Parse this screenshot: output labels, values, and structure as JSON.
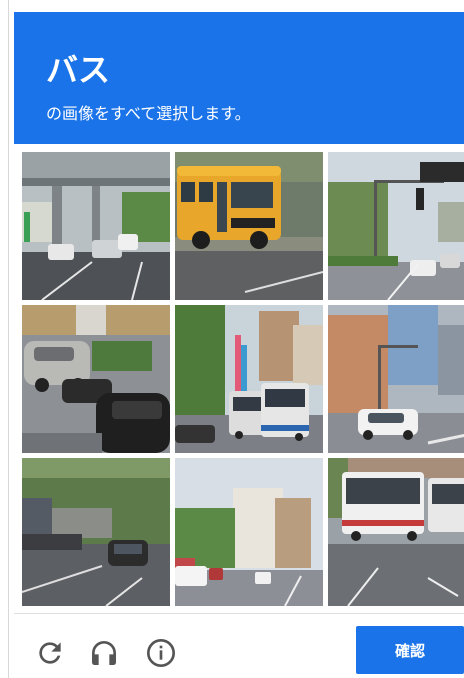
{
  "header": {
    "title": "バス",
    "instruction": "の画像をすべて選択します。"
  },
  "grid": {
    "tiles": [
      {
        "row": 1,
        "col": 1,
        "subject": "street-overpass"
      },
      {
        "row": 1,
        "col": 2,
        "subject": "school-bus"
      },
      {
        "row": 1,
        "col": 3,
        "subject": "traffic-lights"
      },
      {
        "row": 2,
        "col": 1,
        "subject": "parked-cars"
      },
      {
        "row": 2,
        "col": 2,
        "subject": "city-buses"
      },
      {
        "row": 2,
        "col": 3,
        "subject": "intersection-car"
      },
      {
        "row": 3,
        "col": 1,
        "subject": "road-car"
      },
      {
        "row": 3,
        "col": 2,
        "subject": "street-buildings"
      },
      {
        "row": 3,
        "col": 3,
        "subject": "white-bus"
      }
    ]
  },
  "footer": {
    "reload_icon": "reload-icon",
    "audio_icon": "headphones-icon",
    "info_icon": "info-icon",
    "verify_label": "確認"
  },
  "colors": {
    "accent": "#1a73e8",
    "icon": "#555555"
  }
}
